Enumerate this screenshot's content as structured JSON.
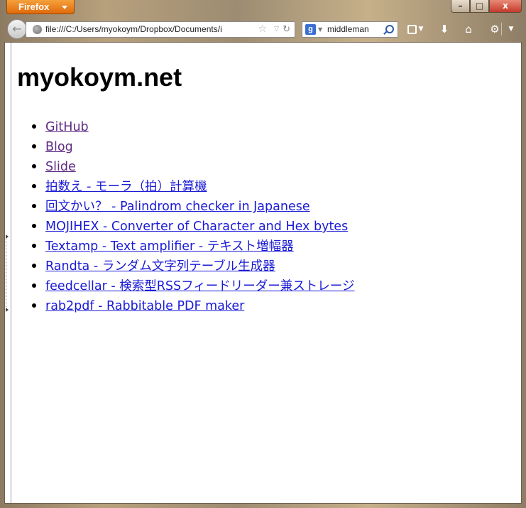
{
  "browser": {
    "menu_button_label": "Firefox",
    "address": "file:///C:/Users/myokoym/Dropbox/Documents/i",
    "search": {
      "engine_letter": "g",
      "query": "middleman"
    },
    "window_controls": {
      "minimize": "–",
      "maximize": "□",
      "close": "x"
    },
    "icons": {
      "back": "back-arrow-icon",
      "site": "globe-icon",
      "bookmark_star": "star-icon",
      "reload": "reload-icon",
      "search": "magnifier-icon",
      "bookmarks": "bookmarks-icon",
      "downloads": "download-arrow-icon",
      "home": "home-icon",
      "addon": "addon-icon"
    },
    "accent_color": "#e06a0c"
  },
  "page": {
    "title": "myokoym.net",
    "links": [
      {
        "label": "GitHub",
        "visited": true
      },
      {
        "label": "Blog",
        "visited": true
      },
      {
        "label": "Slide",
        "visited": true
      },
      {
        "label": "拍数え - モーラ（拍）計算機",
        "visited": false
      },
      {
        "label": "回文かい？ - Palindrom checker in Japanese",
        "visited": false
      },
      {
        "label": "MOJIHEX - Converter of Character and Hex bytes",
        "visited": false
      },
      {
        "label": "Textamp - Text amplifier - テキスト増幅器",
        "visited": false
      },
      {
        "label": "Randta - ランダム文字列テーブル生成器",
        "visited": false
      },
      {
        "label": "feedcellar - 検索型RSSフィードリーダー兼ストレージ",
        "visited": false
      },
      {
        "label": "rab2pdf - Rabbitable PDF maker",
        "visited": false
      }
    ],
    "link_color": "#1a1ad6",
    "visited_link_color": "#5e2a84"
  }
}
